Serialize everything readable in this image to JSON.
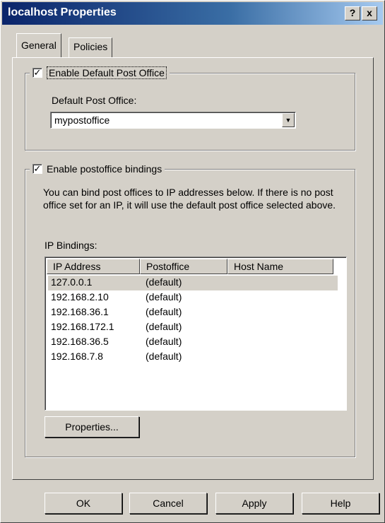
{
  "window": {
    "title": "localhost Properties"
  },
  "titlebar": {
    "help_label": "?",
    "close_label": "x"
  },
  "tabs": [
    {
      "label": "General"
    },
    {
      "label": "Policies"
    }
  ],
  "default_group": {
    "checkbox_label": "Enable Default Post Office",
    "checked": true,
    "field_label": "Default Post Office:",
    "combo_value": "mypostoffice"
  },
  "bindings_group": {
    "checkbox_label": "Enable postoffice bindings",
    "checked": true,
    "description": "You can bind post offices to IP addresses below.  If there is no post office set for an IP, it will use the default post office selected above.",
    "list_label": "IP Bindings:",
    "columns": [
      "IP Address",
      "Postoffice",
      "Host Name"
    ],
    "rows": [
      {
        "ip": "127.0.0.1",
        "postoffice": "(default)",
        "host": ""
      },
      {
        "ip": "192.168.2.10",
        "postoffice": "(default)",
        "host": ""
      },
      {
        "ip": "192.168.36.1",
        "postoffice": "(default)",
        "host": ""
      },
      {
        "ip": "192.168.172.1",
        "postoffice": "(default)",
        "host": ""
      },
      {
        "ip": "192.168.36.5",
        "postoffice": "(default)",
        "host": ""
      },
      {
        "ip": "192.168.7.8",
        "postoffice": "(default)",
        "host": ""
      }
    ],
    "properties_button": "Properties..."
  },
  "footer": {
    "ok": "OK",
    "cancel": "Cancel",
    "apply": "Apply",
    "help": "Help"
  },
  "colors": {
    "face": "#d4d0c8",
    "title_start": "#0a246a",
    "title_end": "#a6caf0"
  },
  "icons": {
    "checkbox": "checkmark-icon",
    "dropdown": "chevron-down-icon"
  }
}
